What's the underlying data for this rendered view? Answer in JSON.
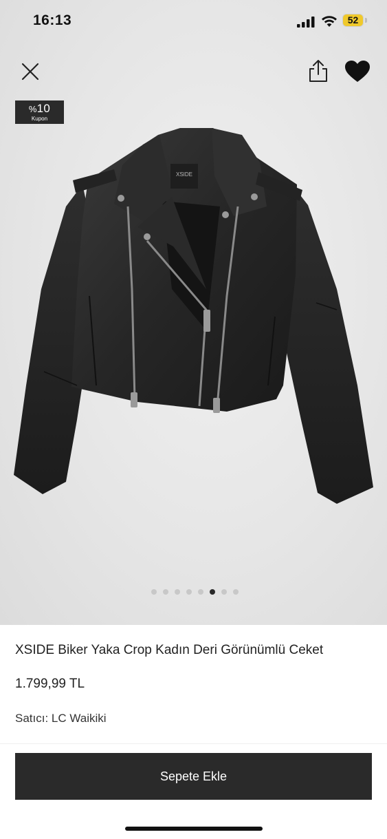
{
  "status_bar": {
    "time": "16:13",
    "battery": "52",
    "battery_color": "#f0c92b"
  },
  "top_bar": {
    "close_icon": "close-icon",
    "share_icon": "share-icon",
    "favorite_icon": "heart-icon"
  },
  "coupon": {
    "percent_sign": "%",
    "percent_value": "10",
    "label": "Kupon"
  },
  "product_image": {
    "brand_tag": "XSIDE",
    "total_images": 8,
    "active_index": 5
  },
  "product": {
    "title": "XSIDE Biker Yaka Crop Kadın Deri Görünümlü Ceket",
    "price": "1.799,99 TL",
    "seller_label": "Satıcı:",
    "seller_name": "LC Waikiki"
  },
  "actions": {
    "add_to_cart": "Sepete Ekle",
    "button_color": "#2a2a2a"
  }
}
